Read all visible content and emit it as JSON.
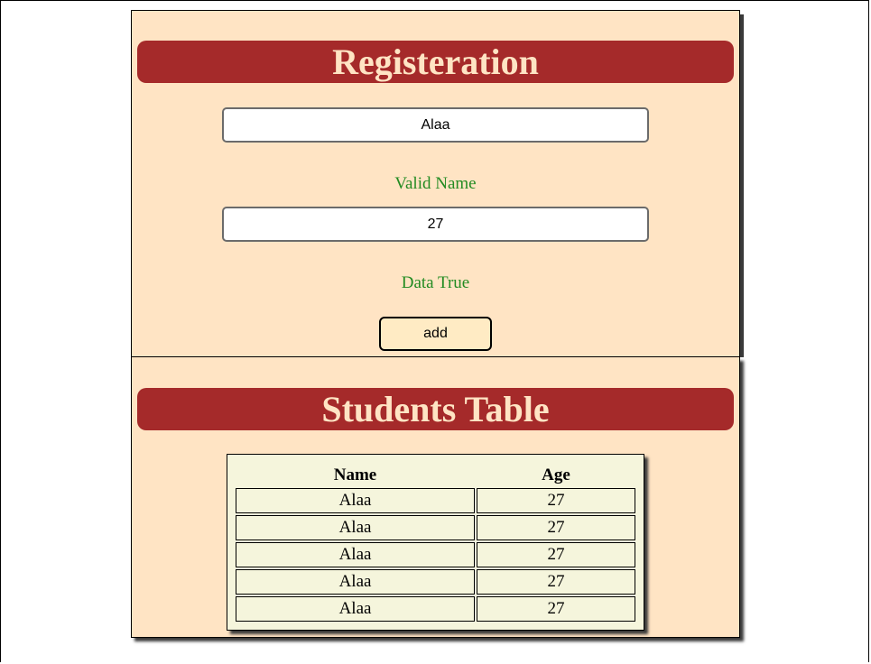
{
  "registration": {
    "title": "Registeration",
    "name_value": "Alaa",
    "name_message": "Valid Name",
    "age_value": "27",
    "age_message": "Data True",
    "add_label": "add"
  },
  "students": {
    "title": "Students Table",
    "columns": [
      "Name",
      "Age"
    ],
    "rows": [
      [
        "Alaa",
        "27"
      ],
      [
        "Alaa",
        "27"
      ],
      [
        "Alaa",
        "27"
      ],
      [
        "Alaa",
        "27"
      ],
      [
        "Alaa",
        "27"
      ]
    ]
  },
  "colors": {
    "card_bg": "#ffe4c4",
    "banner_bg": "#a52a2a",
    "banner_text": "#ffe4c4",
    "valid_text": "#228b22",
    "table_bg": "#f5f5dc",
    "button_bg": "#ffebc4"
  }
}
